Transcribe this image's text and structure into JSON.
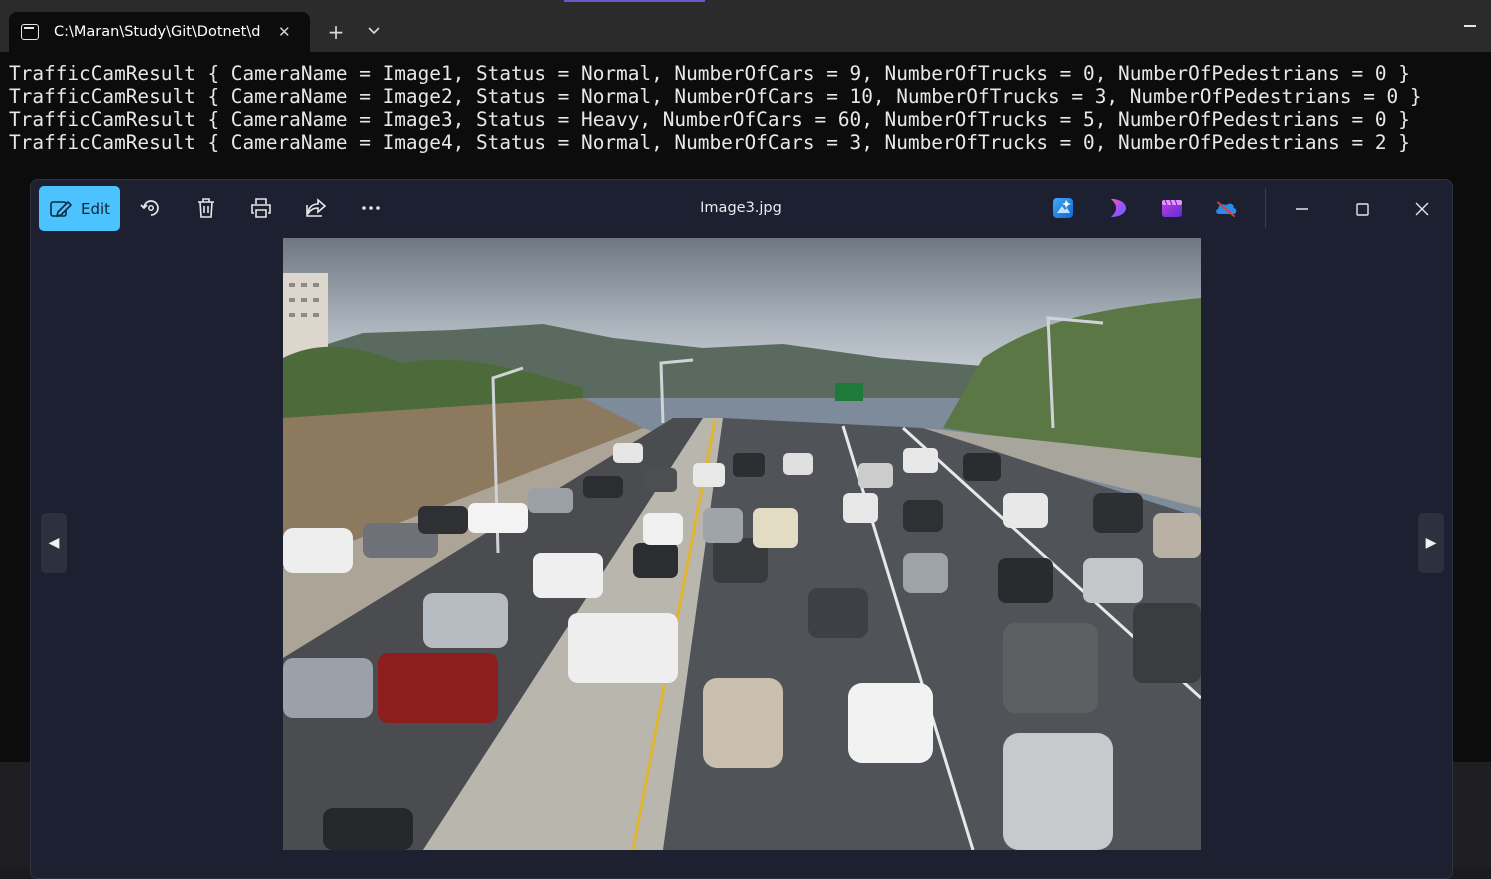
{
  "terminal": {
    "tab_title": "C:\\Maran\\Study\\Git\\Dotnet\\d",
    "output_lines": [
      "TrafficCamResult { CameraName = Image1, Status = Normal, NumberOfCars = 9, NumberOfTrucks = 0, NumberOfPedestrians = 0 }",
      "TrafficCamResult { CameraName = Image2, Status = Normal, NumberOfCars = 10, NumberOfTrucks = 3, NumberOfPedestrians = 0 }",
      "TrafficCamResult { CameraName = Image3, Status = Heavy, NumberOfCars = 60, NumberOfTrucks = 5, NumberOfPedestrians = 0 }",
      "TrafficCamResult { CameraName = Image4, Status = Normal, NumberOfCars = 3, NumberOfTrucks = 0, NumberOfPedestrians = 2 }"
    ]
  },
  "viewer": {
    "edit_label": "Edit",
    "image_title": "Image3.jpg",
    "toolbar_icons": [
      "edit-icon",
      "rotate-icon",
      "delete-icon",
      "print-icon",
      "share-icon",
      "more-icon"
    ],
    "app_icons": [
      "designer-icon",
      "clipchamp-icon",
      "photos-icon",
      "onedrive-icon"
    ],
    "accent_color": "#4cc2ff"
  }
}
